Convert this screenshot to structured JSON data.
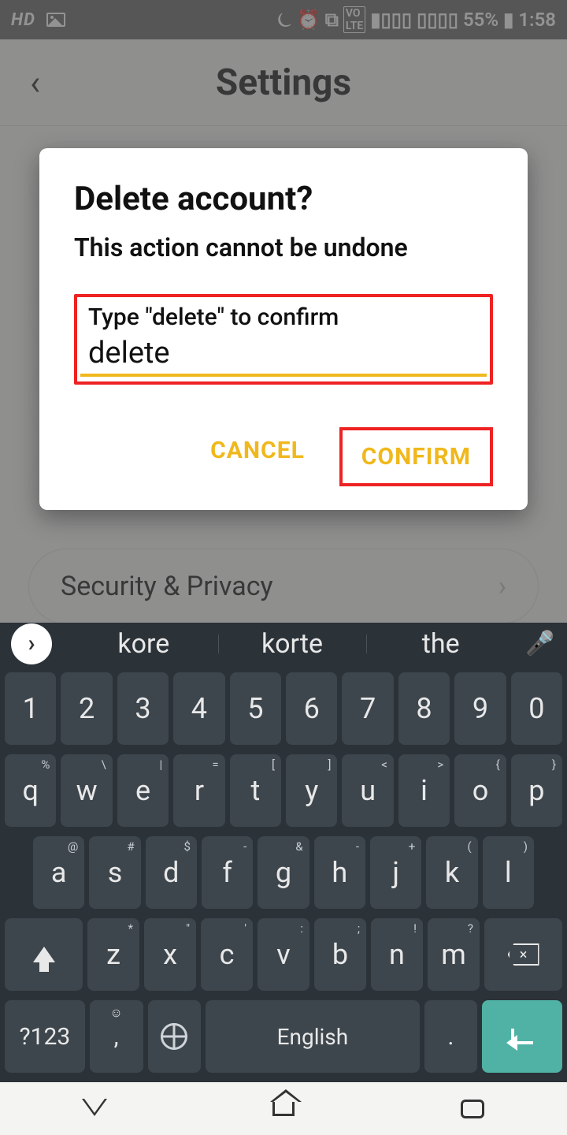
{
  "status": {
    "hd": "HD",
    "battery": "55%",
    "time": "1:58"
  },
  "header": {
    "title": "Settings"
  },
  "list": {
    "securityPrivacy": "Security & Privacy"
  },
  "dialog": {
    "title": "Delete account?",
    "subtitle": "This action cannot be undone",
    "inputLabel": "Type \"delete\" to confirm",
    "inputValue": "delete",
    "cancel": "CANCEL",
    "confirm": "CONFIRM"
  },
  "keyboard": {
    "suggestions": [
      "kore",
      "korte",
      "the"
    ],
    "row1": [
      "1",
      "2",
      "3",
      "4",
      "5",
      "6",
      "7",
      "8",
      "9",
      "0"
    ],
    "row2": [
      {
        "k": "q",
        "s": "%"
      },
      {
        "k": "w",
        "s": "\\"
      },
      {
        "k": "e",
        "s": "|"
      },
      {
        "k": "r",
        "s": "="
      },
      {
        "k": "t",
        "s": "["
      },
      {
        "k": "y",
        "s": "]"
      },
      {
        "k": "u",
        "s": "<"
      },
      {
        "k": "i",
        "s": ">"
      },
      {
        "k": "o",
        "s": "{"
      },
      {
        "k": "p",
        "s": "}"
      }
    ],
    "row3": [
      {
        "k": "a",
        "s": "@"
      },
      {
        "k": "s",
        "s": "#"
      },
      {
        "k": "d",
        "s": "$"
      },
      {
        "k": "f",
        "s": "-"
      },
      {
        "k": "g",
        "s": "&"
      },
      {
        "k": "h",
        "s": "-"
      },
      {
        "k": "j",
        "s": "+"
      },
      {
        "k": "k",
        "s": "("
      },
      {
        "k": "l",
        "s": ")"
      }
    ],
    "row4": [
      {
        "k": "z",
        "s": "*"
      },
      {
        "k": "x",
        "s": "\""
      },
      {
        "k": "c",
        "s": "'"
      },
      {
        "k": "v",
        "s": ":"
      },
      {
        "k": "b",
        "s": ";"
      },
      {
        "k": "n",
        "s": "!"
      },
      {
        "k": "m",
        "s": "?"
      }
    ],
    "symKey": "?123",
    "comma": ",",
    "space": "English",
    "period": "."
  }
}
